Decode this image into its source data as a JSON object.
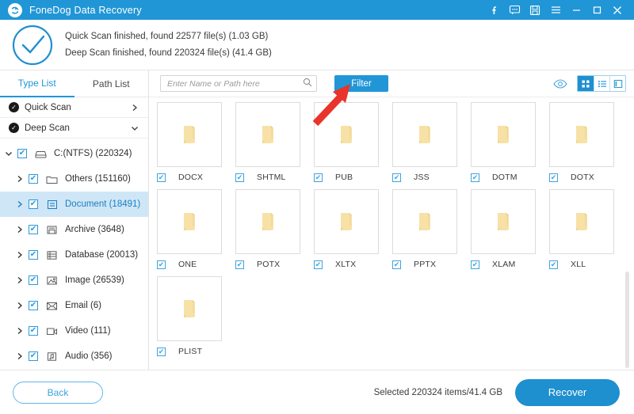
{
  "window": {
    "title": "FoneDog Data Recovery",
    "logo_icon": "app-logo-icon",
    "accent_color": "#2196d6",
    "controls": [
      {
        "name": "facebook-icon",
        "glyph": "f"
      },
      {
        "name": "feedback-icon",
        "glyph": "speech-bubble"
      },
      {
        "name": "save-icon",
        "glyph": "floppy-disk"
      },
      {
        "name": "menu-icon",
        "glyph": "hamburger"
      },
      {
        "name": "minimize-icon",
        "glyph": "minus"
      },
      {
        "name": "maximize-icon",
        "glyph": "square"
      },
      {
        "name": "close-icon",
        "glyph": "x"
      }
    ]
  },
  "summary": {
    "status_icon": "check-circle-icon",
    "line1": "Quick Scan finished, found 22577 file(s) (1.03 GB)",
    "line2": "Deep Scan finished, found 220324 file(s) (41.4 GB)"
  },
  "sidebar": {
    "tabs": [
      {
        "label": "Type List",
        "active": true
      },
      {
        "label": "Path List",
        "active": false
      }
    ],
    "scan_rows": [
      {
        "label": "Quick Scan",
        "chevron": "chevron-right-icon"
      },
      {
        "label": "Deep Scan",
        "chevron": "chevron-down-icon"
      }
    ],
    "tree": [
      {
        "label": "C:(NTFS) (220324)",
        "icon": "drive-icon",
        "level": 1,
        "arrow": "chevron-down-icon",
        "checked": true,
        "selected": false
      },
      {
        "label": "Others (151160)",
        "icon": "folder-icon",
        "level": 2,
        "arrow": "chevron-right-icon",
        "checked": true,
        "selected": false
      },
      {
        "label": "Document (18491)",
        "icon": "document-icon",
        "level": 2,
        "arrow": "chevron-right-icon",
        "checked": true,
        "selected": true
      },
      {
        "label": "Archive (3648)",
        "icon": "archive-icon",
        "level": 2,
        "arrow": "chevron-right-icon",
        "checked": true,
        "selected": false
      },
      {
        "label": "Database (20013)",
        "icon": "database-icon",
        "level": 2,
        "arrow": "chevron-right-icon",
        "checked": true,
        "selected": false
      },
      {
        "label": "Image (26539)",
        "icon": "image-icon",
        "level": 2,
        "arrow": "chevron-right-icon",
        "checked": true,
        "selected": false
      },
      {
        "label": "Email (6)",
        "icon": "email-icon",
        "level": 2,
        "arrow": "chevron-right-icon",
        "checked": true,
        "selected": false
      },
      {
        "label": "Video (111)",
        "icon": "video-icon",
        "level": 2,
        "arrow": "chevron-right-icon",
        "checked": true,
        "selected": false
      },
      {
        "label": "Audio (356)",
        "icon": "audio-icon",
        "level": 2,
        "arrow": "chevron-right-icon",
        "checked": true,
        "selected": false
      }
    ]
  },
  "toolbar": {
    "search_placeholder": "Enter Name or Path here",
    "search_value": "",
    "search_icon": "search-icon",
    "filter_label": "Filter",
    "preview_icon": "eye-icon",
    "views": [
      {
        "name": "grid-view-button",
        "icon": "grid-icon",
        "active": true
      },
      {
        "name": "list-view-button",
        "icon": "list-icon",
        "active": false
      },
      {
        "name": "detail-view-button",
        "icon": "split-panel-icon",
        "active": false
      }
    ]
  },
  "grid": {
    "item_icon": "folder-icon",
    "items": [
      {
        "label": "DOCX",
        "checked": true
      },
      {
        "label": "SHTML",
        "checked": true
      },
      {
        "label": "PUB",
        "checked": true
      },
      {
        "label": "JSS",
        "checked": true
      },
      {
        "label": "DOTM",
        "checked": true
      },
      {
        "label": "DOTX",
        "checked": true
      },
      {
        "label": "ONE",
        "checked": true
      },
      {
        "label": "POTX",
        "checked": true
      },
      {
        "label": "XLTX",
        "checked": true
      },
      {
        "label": "PPTX",
        "checked": true
      },
      {
        "label": "XLAM",
        "checked": true
      },
      {
        "label": "XLL",
        "checked": true
      },
      {
        "label": "PLIST",
        "checked": true
      }
    ]
  },
  "footer": {
    "back_label": "Back",
    "selected_text": "Selected 220324 items/41.4 GB",
    "recover_label": "Recover"
  },
  "annotation": {
    "arrow_color": "#e8342a",
    "arrow_target": "filter-button"
  }
}
